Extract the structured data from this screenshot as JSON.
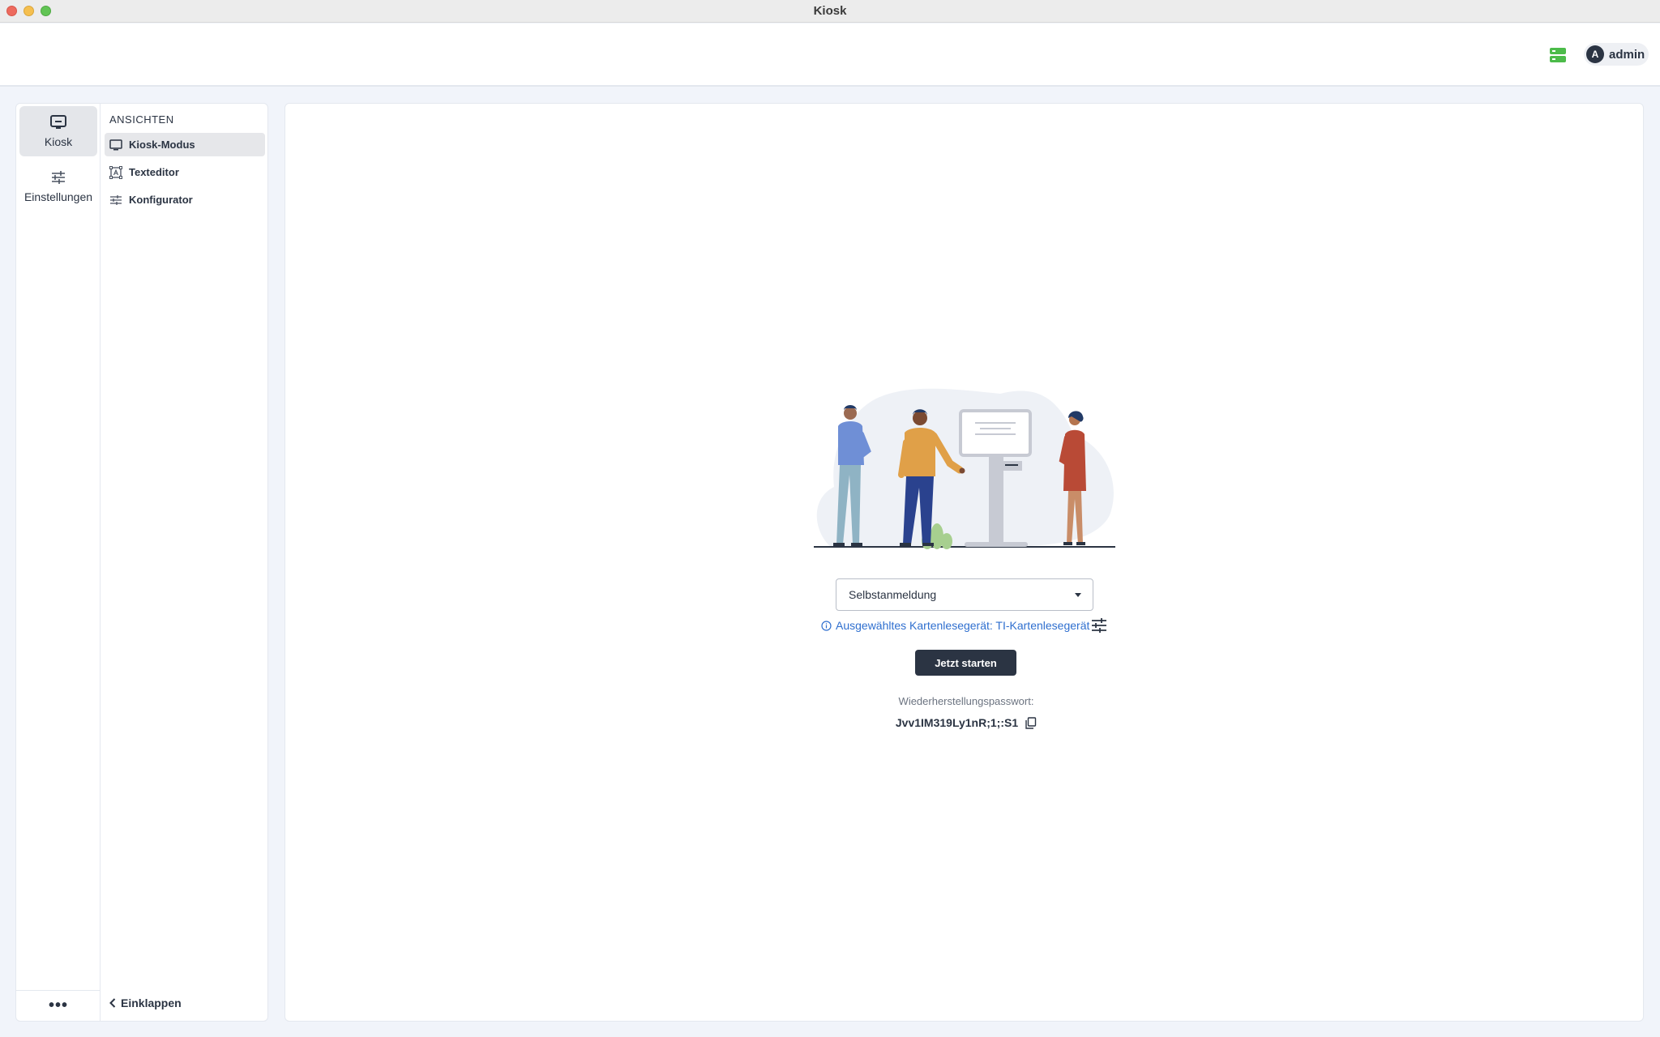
{
  "window": {
    "title": "Kiosk"
  },
  "header": {
    "user_initial": "A",
    "user_name": "admin"
  },
  "rail": {
    "items": [
      {
        "label": "Kiosk",
        "icon": "kiosk-screen-icon",
        "active": true
      },
      {
        "label": "Einstellungen",
        "icon": "sliders-icon",
        "active": false
      }
    ],
    "more_label": "•••"
  },
  "subnav": {
    "section_title": "ANSICHTEN",
    "items": [
      {
        "label": "Kiosk-Modus",
        "icon": "monitor-icon",
        "active": true
      },
      {
        "label": "Texteditor",
        "icon": "text-frame-icon",
        "active": false
      },
      {
        "label": "Konfigurator",
        "icon": "tune-icon",
        "active": false
      }
    ],
    "collapse_label": "Einklappen"
  },
  "main": {
    "mode_select": {
      "value": "Selbstanmeldung"
    },
    "reader_info": "Ausgewähltes Kartenlesegerät: TI-Kartenlesegerät",
    "start_button": "Jetzt starten",
    "recovery_label": "Wiederherstellungspasswort:",
    "recovery_value": "Jvv1IM319Ly1nR;1;:S1"
  },
  "colors": {
    "primary_dark": "#2b3443",
    "link_blue": "#2f6fcf",
    "server_green": "#4cbb4a",
    "app_background": "#f1f4fa"
  }
}
